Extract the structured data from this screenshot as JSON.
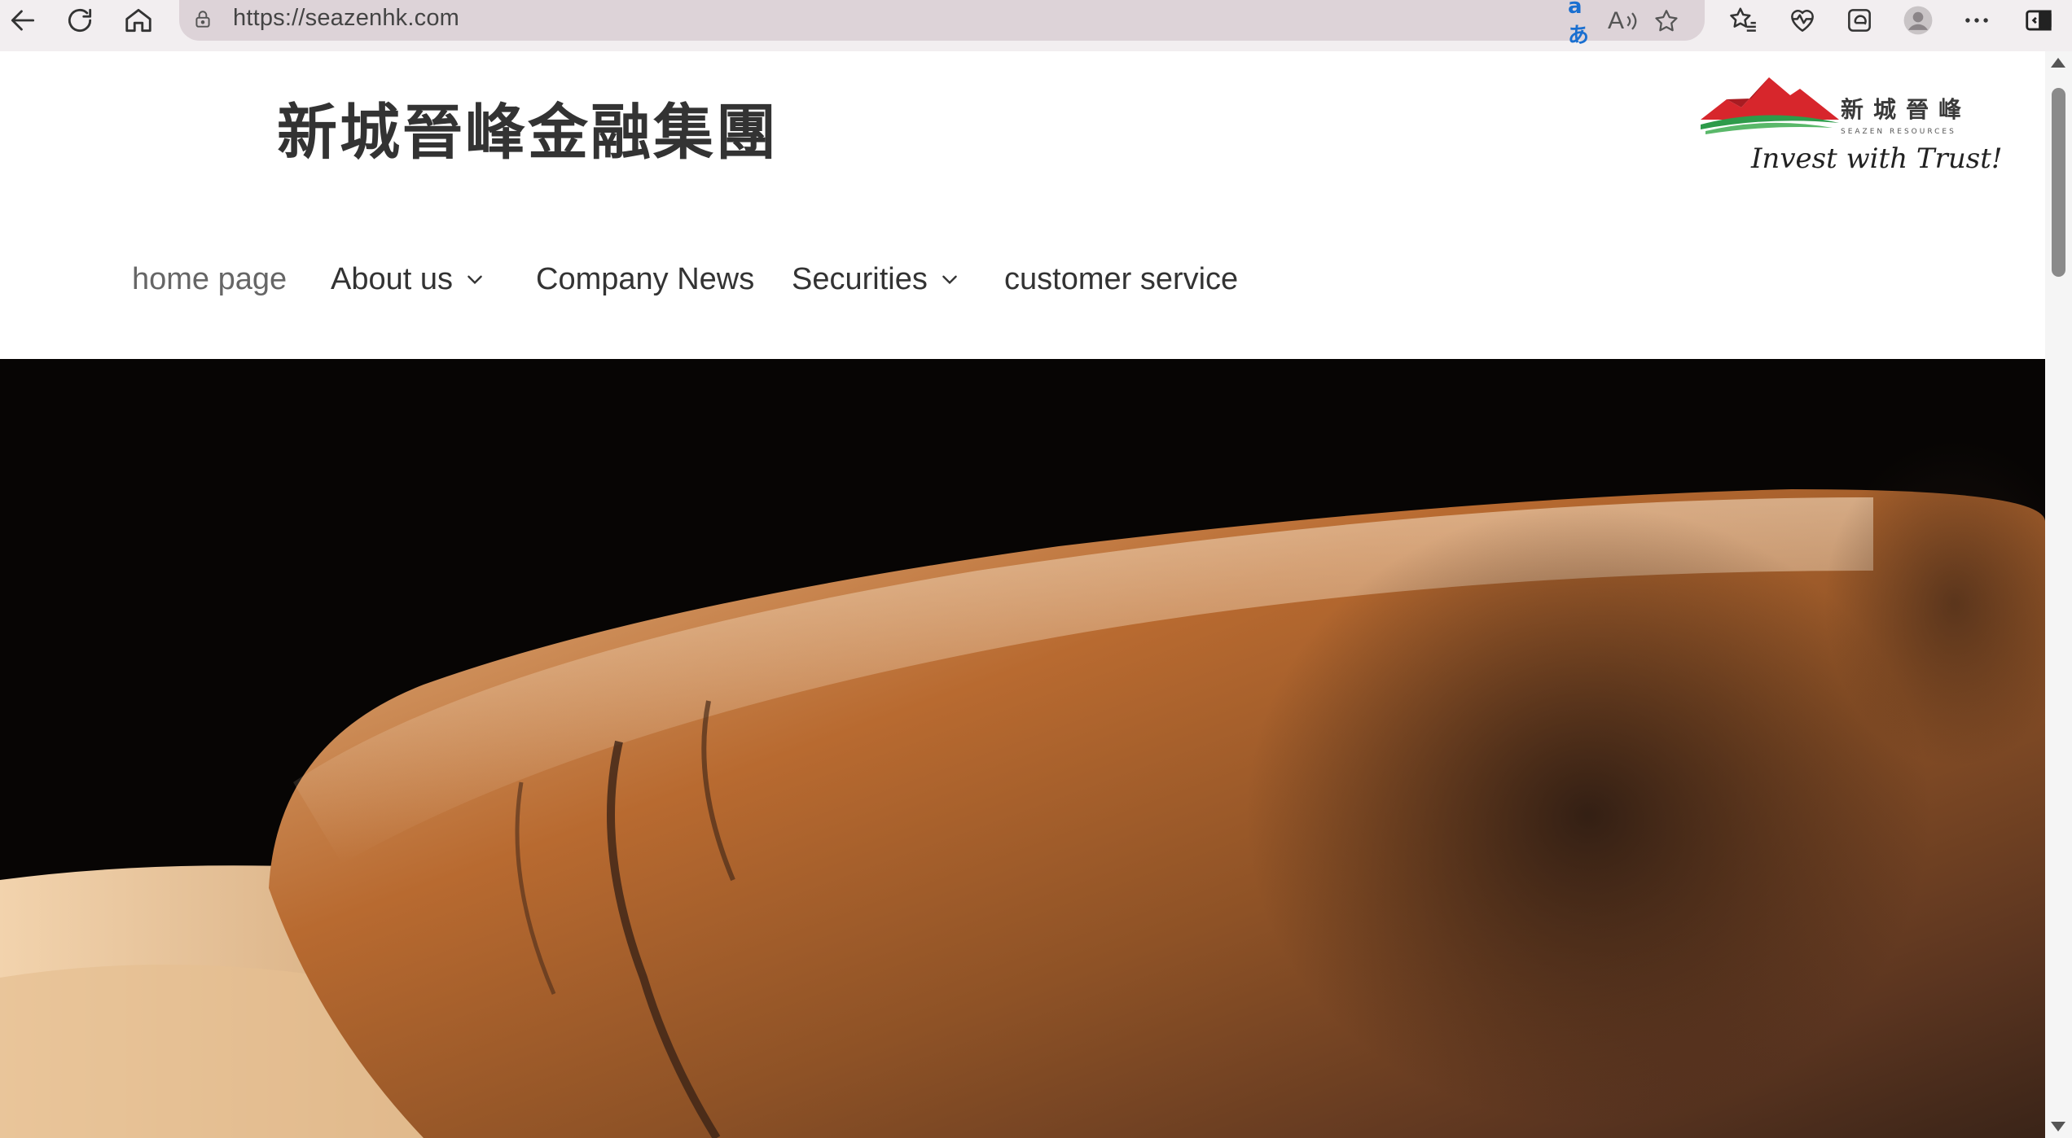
{
  "browser": {
    "url": "https://seazenhk.com",
    "icons": {
      "back": "back-arrow-icon",
      "refresh": "refresh-icon",
      "home": "home-icon",
      "lock": "lock-icon",
      "translate": "translate-icon",
      "read_aloud": "read-aloud-icon",
      "favorite": "star-icon",
      "favorites_bar": "favorites-icon",
      "health": "browser-essentials-icon",
      "collections": "edge-collections-icon",
      "profile": "profile-avatar-icon",
      "more": "more-options-icon",
      "sidebar": "sidebar-toggle-icon"
    },
    "translate_glyph": "aあ",
    "read_aloud_glyph": "A",
    "accent_color": "#1a6fd0"
  },
  "site": {
    "title": "新城晉峰金融集團",
    "logo": {
      "cn": "新城晉峰",
      "en": "SEAZEN RESOURCES",
      "slogan": "Invest with Trust!",
      "colors": {
        "red": "#d7262c",
        "green": "#2e9b4a"
      }
    },
    "nav": [
      {
        "label": "home page",
        "active": true,
        "dropdown": false
      },
      {
        "label": "About us",
        "active": false,
        "dropdown": true
      },
      {
        "label": "Company News",
        "active": false,
        "dropdown": false
      },
      {
        "label": "Securities",
        "active": false,
        "dropdown": true
      },
      {
        "label": "customer service",
        "active": false,
        "dropdown": false
      }
    ]
  }
}
